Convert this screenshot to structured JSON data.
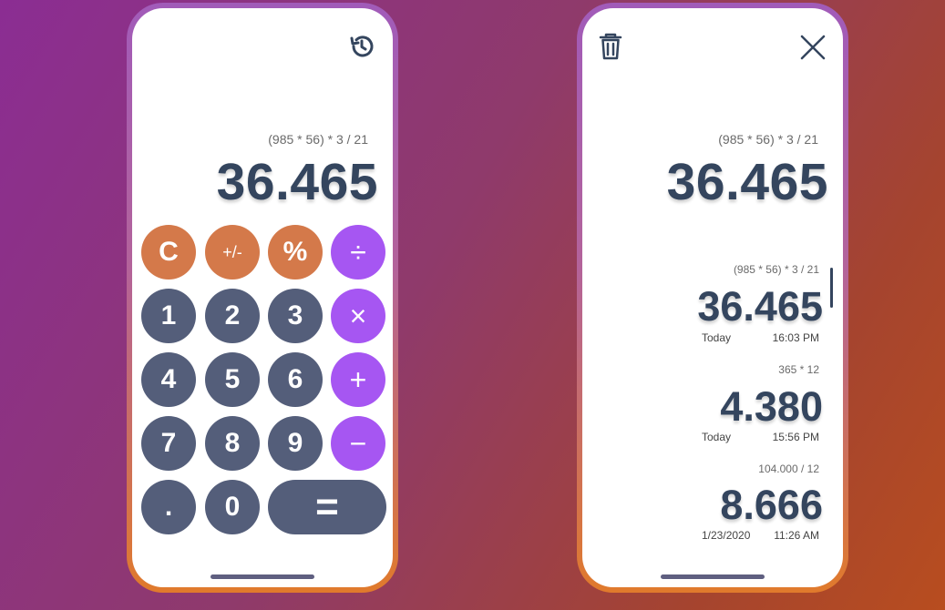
{
  "calculator": {
    "expression": "(985 * 56) * 3 / 21",
    "result": "36.465",
    "history_icon": "history-icon",
    "keys": [
      {
        "label": "C",
        "type": "fn",
        "name": "clear"
      },
      {
        "label": "+/-",
        "type": "fn",
        "name": "toggle-sign"
      },
      {
        "label": "%",
        "type": "fn",
        "name": "percent"
      },
      {
        "label": "÷",
        "type": "op",
        "name": "divide"
      },
      {
        "label": "1",
        "type": "num",
        "name": "digit-1"
      },
      {
        "label": "2",
        "type": "num",
        "name": "digit-2"
      },
      {
        "label": "3",
        "type": "num",
        "name": "digit-3"
      },
      {
        "label": "×",
        "type": "op",
        "name": "multiply"
      },
      {
        "label": "4",
        "type": "num",
        "name": "digit-4"
      },
      {
        "label": "5",
        "type": "num",
        "name": "digit-5"
      },
      {
        "label": "6",
        "type": "num",
        "name": "digit-6"
      },
      {
        "label": "+",
        "type": "op",
        "name": "add"
      },
      {
        "label": "7",
        "type": "num",
        "name": "digit-7"
      },
      {
        "label": "8",
        "type": "num",
        "name": "digit-8"
      },
      {
        "label": "9",
        "type": "num",
        "name": "digit-9"
      },
      {
        "label": "−",
        "type": "op",
        "name": "subtract"
      },
      {
        "label": ".",
        "type": "num",
        "name": "decimal"
      },
      {
        "label": "0",
        "type": "num",
        "name": "digit-0"
      },
      {
        "label": "=",
        "type": "num",
        "name": "equals"
      }
    ]
  },
  "history": {
    "trash_icon": "trash-icon",
    "close_icon": "close-icon",
    "current": {
      "expression": "(985 * 56) * 3 / 21",
      "result": "36.465"
    },
    "entries": [
      {
        "expression": "(985 * 56) * 3 / 21",
        "result": "36.465",
        "day": "Today",
        "time": "16:03 PM"
      },
      {
        "expression": "365 * 12",
        "result": "4.380",
        "day": "Today",
        "time": "15:56 PM"
      },
      {
        "expression": "104.000 / 12",
        "result": "8.666",
        "day": "1/23/2020",
        "time": "11:26 AM"
      }
    ]
  },
  "colors": {
    "number_key": "#545e7a",
    "function_key": "#d4794a",
    "operator_key": "#a656f2",
    "result_text": "#34455e"
  }
}
